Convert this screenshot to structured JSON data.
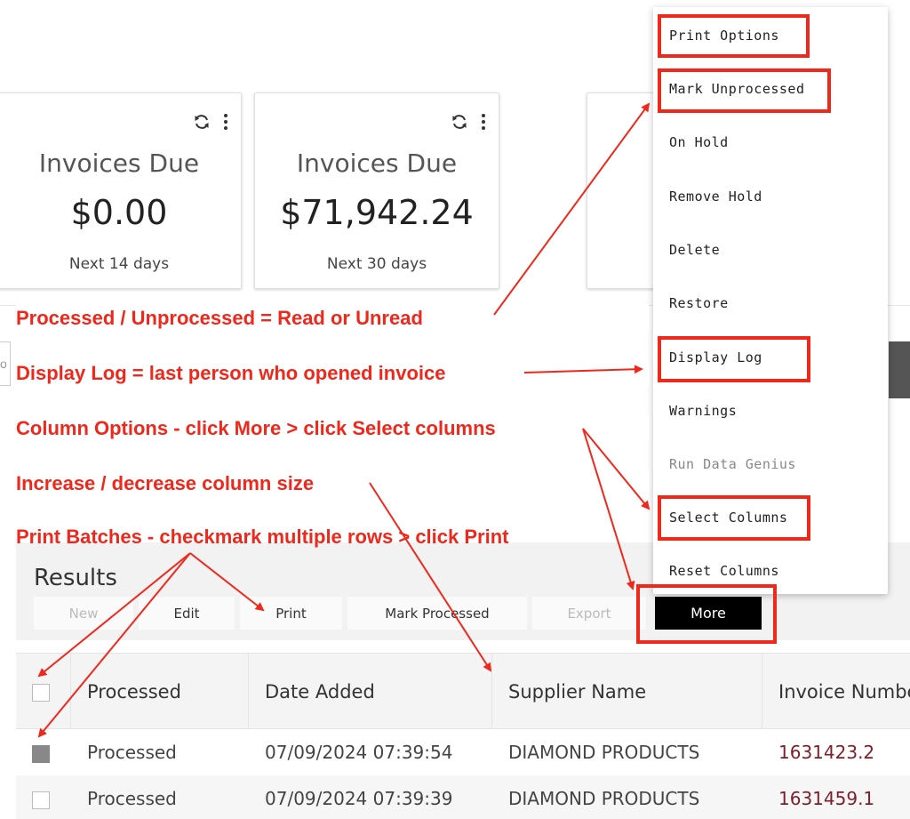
{
  "cards": [
    {
      "title": "Invoices Due",
      "value": "$0.00",
      "subtitle": "Next 14 days"
    },
    {
      "title": "Invoices Due",
      "value": "$71,942.24",
      "subtitle": "Next 30 days"
    }
  ],
  "card_icons": [
    "refresh-icon",
    "more-vertical-icon"
  ],
  "search_edge_text": "o",
  "results": {
    "title": "Results",
    "toolbar": {
      "new": "New",
      "edit": "Edit",
      "print": "Print",
      "mark_processed": "Mark Processed",
      "export": "Export",
      "more": "More"
    }
  },
  "table": {
    "columns": [
      "Processed",
      "Date Added",
      "Supplier Name",
      "Invoice Number"
    ],
    "rows": [
      {
        "processed": "Processed",
        "date_added": "07/09/2024 07:39:54",
        "supplier": "DIAMOND PRODUCTS",
        "invoice": "1631423.2",
        "checked": true
      },
      {
        "processed": "Processed",
        "date_added": "07/09/2024 07:39:39",
        "supplier": "DIAMOND PRODUCTS",
        "invoice": "1631459.1",
        "checked": false
      }
    ]
  },
  "menu": {
    "items": [
      {
        "label": "Print Options",
        "disabled": false
      },
      {
        "label": "Mark Unprocessed",
        "disabled": false
      },
      {
        "label": "On Hold",
        "disabled": false
      },
      {
        "label": "Remove Hold",
        "disabled": false
      },
      {
        "label": "Delete",
        "disabled": false
      },
      {
        "label": "Restore",
        "disabled": false
      },
      {
        "label": "Display Log",
        "disabled": false
      },
      {
        "label": "Warnings",
        "disabled": false
      },
      {
        "label": "Run Data Genius",
        "disabled": true
      },
      {
        "label": "Select Columns",
        "disabled": false
      },
      {
        "label": "Reset Columns",
        "disabled": false
      }
    ]
  },
  "annotations": {
    "processed": "Processed / Unprocessed = Read or Unread",
    "display_log": "Display Log = last person who opened invoice",
    "column_options": "Column Options - click More > click Select columns",
    "column_size": "Increase / decrease column size",
    "print_batches": "Print Batches - checkmark multiple rows > click Print"
  },
  "colors": {
    "annotation_red": "#f0281c",
    "invoice_link": "#7a1f2b",
    "more_button_bg": "#000000"
  }
}
